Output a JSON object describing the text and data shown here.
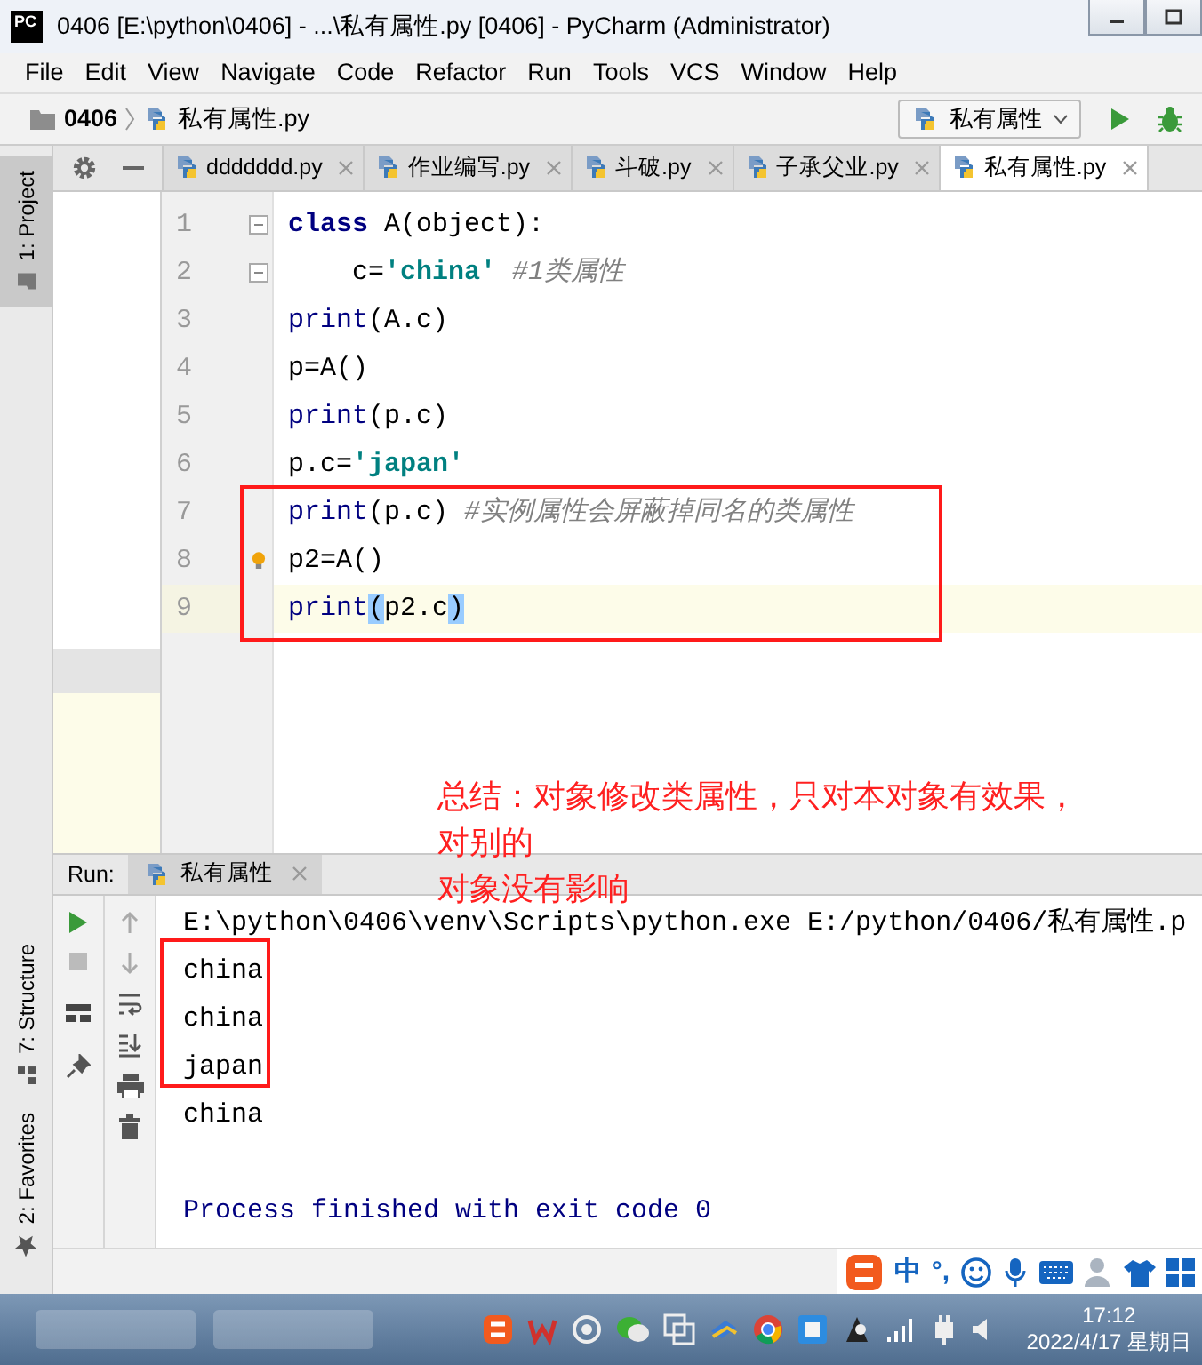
{
  "window": {
    "logo": "PC",
    "title": "0406 [E:\\python\\0406] - ...\\私有属性.py [0406] - PyCharm (Administrator)"
  },
  "menu": [
    "File",
    "Edit",
    "View",
    "Navigate",
    "Code",
    "Refactor",
    "Run",
    "Tools",
    "VCS",
    "Window",
    "Help"
  ],
  "breadcrumbs": [
    {
      "label": "0406",
      "kind": "folder"
    },
    {
      "label": "私有属性.py",
      "kind": "file"
    }
  ],
  "run_config": {
    "label": "私有属性"
  },
  "tool_windows": {
    "top": [
      {
        "label": "1: Project",
        "selected": true
      }
    ],
    "bottom": [
      {
        "label": "7: Structure",
        "selected": false
      },
      {
        "label": "2: Favorites",
        "selected": false
      }
    ]
  },
  "editor_tabs": [
    {
      "label": "ddddddd.py",
      "selected": false
    },
    {
      "label": "作业编写.py",
      "selected": false
    },
    {
      "label": "斗破.py",
      "selected": false
    },
    {
      "label": "子承父业.py",
      "selected": false
    },
    {
      "label": "私有属性.py",
      "selected": true
    }
  ],
  "code_lines": [
    {
      "number": "1",
      "fold": true,
      "current": false,
      "bulb": false,
      "tokens": [
        {
          "text": "class",
          "kind": "keyword"
        },
        {
          "text": " A(object):",
          "kind": "plain"
        }
      ]
    },
    {
      "number": "2",
      "fold": true,
      "current": false,
      "bulb": false,
      "tokens": [
        {
          "text": "    c=",
          "kind": "plain"
        },
        {
          "text": "'china'",
          "kind": "string"
        },
        {
          "text": "#1类属性",
          "kind": "comment"
        }
      ]
    },
    {
      "number": "3",
      "fold": false,
      "current": false,
      "bulb": false,
      "tokens": [
        {
          "text": "print",
          "kind": "builtin"
        },
        {
          "text": "(A.c)",
          "kind": "plain"
        }
      ]
    },
    {
      "number": "4",
      "fold": false,
      "current": false,
      "bulb": false,
      "tokens": [
        {
          "text": "p=A()",
          "kind": "plain"
        }
      ]
    },
    {
      "number": "5",
      "fold": false,
      "current": false,
      "bulb": false,
      "tokens": [
        {
          "text": "print",
          "kind": "builtin"
        },
        {
          "text": "(p.c)",
          "kind": "plain"
        }
      ]
    },
    {
      "number": "6",
      "fold": false,
      "current": false,
      "bulb": false,
      "tokens": [
        {
          "text": "p.c=",
          "kind": "plain"
        },
        {
          "text": "'japan'",
          "kind": "string"
        }
      ]
    },
    {
      "number": "7",
      "fold": false,
      "current": false,
      "bulb": false,
      "tokens": [
        {
          "text": "print",
          "kind": "builtin"
        },
        {
          "text": "(p.c)",
          "kind": "plain"
        },
        {
          "text": "#实例属性会屏蔽掉同名的类属性",
          "kind": "comment"
        }
      ]
    },
    {
      "number": "8",
      "fold": false,
      "current": false,
      "bulb": true,
      "tokens": [
        {
          "text": "p2=A()",
          "kind": "plain"
        }
      ]
    },
    {
      "number": "9",
      "fold": false,
      "current": true,
      "bulb": false,
      "tokens": [
        {
          "text": "print",
          "kind": "builtin"
        },
        {
          "text": "(",
          "kind": "match"
        },
        {
          "text": "p2.c",
          "kind": "plain"
        },
        {
          "text": ")",
          "kind": "match"
        }
      ]
    }
  ],
  "annotation": {
    "lines": [
      "总结：对象修改类属性，只对本对象有效果，",
      "对别的",
      "对象没有影响"
    ]
  },
  "run_panel": {
    "label": "Run:",
    "tab": "私有属性",
    "output": [
      {
        "text": "E:\\python\\0406\\venv\\Scripts\\python.exe E:/python/0406/私有属性.p",
        "kind": "command"
      },
      {
        "text": "china",
        "kind": "stdout"
      },
      {
        "text": "china",
        "kind": "stdout"
      },
      {
        "text": "japan",
        "kind": "stdout"
      },
      {
        "text": "china",
        "kind": "stdout"
      },
      {
        "text": "Process finished with exit code 0",
        "kind": "exit"
      }
    ]
  },
  "ime_toolbar": {
    "mode": "中",
    "punctuation": "°,"
  },
  "taskbar": {
    "time": "17:12",
    "date": "2022/4/17 星期日"
  }
}
